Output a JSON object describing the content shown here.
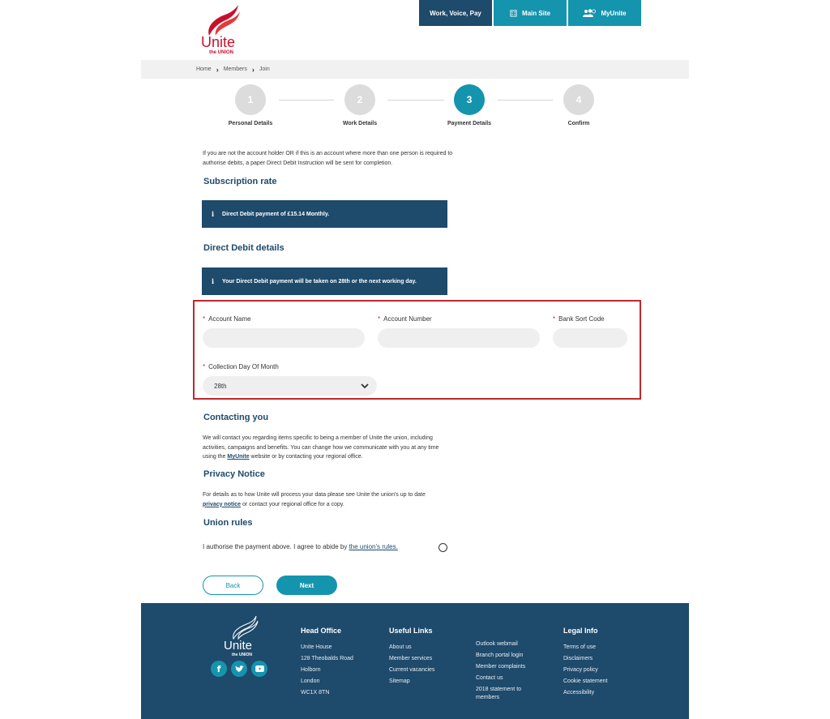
{
  "header": {
    "logo": {
      "main": "Unite",
      "sub": "the UNION"
    },
    "nav": [
      {
        "label": "Work, Voice, Pay",
        "icon": ""
      },
      {
        "label": "Main Site",
        "icon": "building-icon"
      },
      {
        "label": "MyUnite",
        "icon": "users-icon"
      }
    ]
  },
  "breadcrumb": [
    "Home",
    "Members",
    "Join"
  ],
  "steps": [
    {
      "number": "1",
      "label": "Personal Details",
      "active": false
    },
    {
      "number": "2",
      "label": "Work Details",
      "active": false
    },
    {
      "number": "3",
      "label": "Payment Details",
      "active": true
    },
    {
      "number": "4",
      "label": "Confirm",
      "active": false
    }
  ],
  "intro": "If you are not the account holder OR if this is an account where more than one person is required to authorise debits, a paper Direct Debit Instruction will be sent for completion.",
  "subscription": {
    "title": "Subscription rate",
    "info_icon": "i",
    "info": "Direct Debit payment of £15.14 Monthly."
  },
  "direct_debit": {
    "title": "Direct Debit details",
    "info_icon": "i",
    "info": "Your Direct Debit payment will be taken on 28th or the next working day."
  },
  "form": {
    "required_mark": "*",
    "account_name": {
      "label": "Account Name",
      "value": ""
    },
    "account_number": {
      "label": "Account Number",
      "value": ""
    },
    "sort_code": {
      "label": "Bank Sort Code",
      "value": ""
    },
    "collection_day": {
      "label": "Collection Day Of Month",
      "value": "28th"
    }
  },
  "contacting": {
    "title": "Contacting you",
    "text_before": "We will contact you regarding items specific to being a member of Unite the union, including activities, campaigns and benefits. You can change how we communicate with you at any time using the ",
    "link": "MyUnite",
    "text_after": " website or by contacting your regional office."
  },
  "privacy": {
    "title": "Privacy Notice",
    "text_before": "For details as to how Unite will process your data please see Unite the union's up to date ",
    "link": "privacy notice",
    "text_after": " or contact your regional office for a copy."
  },
  "rules": {
    "title": "Union rules",
    "text": "I authorise the payment above. I agree to abide by ",
    "link": "the union's rules."
  },
  "buttons": {
    "back": "Back",
    "next": "Next"
  },
  "footer": {
    "logo": {
      "main": "Unite",
      "sub": "the UNION"
    },
    "social": [
      "facebook-icon",
      "twitter-icon",
      "youtube-icon"
    ],
    "head_office": {
      "title": "Head Office",
      "lines": [
        "Unite House",
        "128 Theobalds Road",
        "Holborn",
        "London",
        "WC1X 8TN"
      ]
    },
    "useful_links": {
      "title": "Useful Links",
      "col1": [
        "About us",
        "Member services",
        "Current vacancies",
        "Sitemap"
      ],
      "col2": [
        "Outlook webmail",
        "Branch portal login",
        "Member complaints",
        "Contact us",
        "2018 statement to members"
      ]
    },
    "legal": {
      "title": "Legal Info",
      "lines": [
        "Terms of use",
        "Disclaimers",
        "Privacy policy",
        "Cookie statement",
        "Accessibility"
      ]
    }
  }
}
